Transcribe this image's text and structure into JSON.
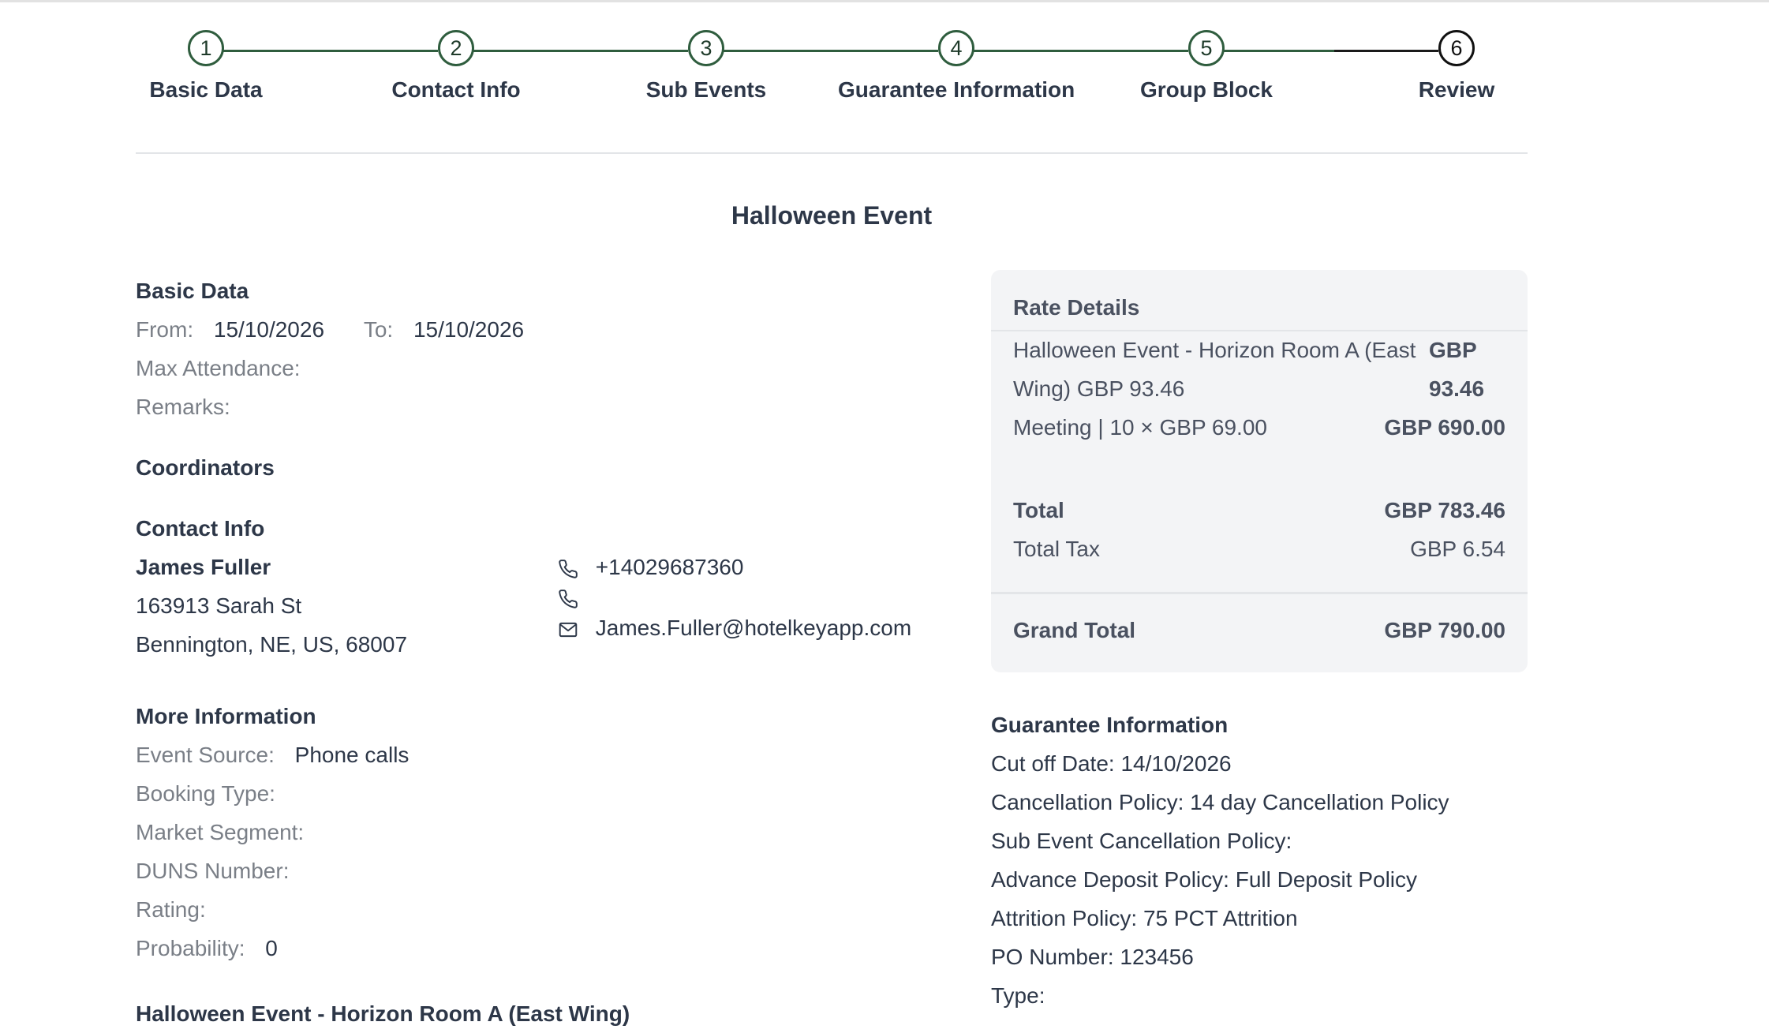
{
  "stepper": {
    "steps": [
      {
        "number": "1",
        "label": "Basic Data"
      },
      {
        "number": "2",
        "label": "Contact Info"
      },
      {
        "number": "3",
        "label": "Sub Events"
      },
      {
        "number": "4",
        "label": "Guarantee Information"
      },
      {
        "number": "5",
        "label": "Group Block"
      },
      {
        "number": "6",
        "label": "Review"
      }
    ],
    "current_step": 6,
    "colors": {
      "done": "#2f5d3e",
      "pending": "#1a1a1a"
    }
  },
  "event_title": "Halloween Event",
  "basic_data": {
    "title": "Basic Data",
    "from_label": "From:",
    "from_value": "15/10/2026",
    "to_label": "To:",
    "to_value": "15/10/2026",
    "max_attendance_label": "Max Attendance:",
    "remarks_label": "Remarks:"
  },
  "coordinators": {
    "title": "Coordinators"
  },
  "contact_info": {
    "title": "Contact Info",
    "name": "James Fuller",
    "address_line1": "163913 Sarah St",
    "address_line2": "Bennington, NE, US, 68007",
    "phone": "+14029687360",
    "phone2": "",
    "email": "James.Fuller@hotelkeyapp.com"
  },
  "more_information": {
    "title": "More Information",
    "event_source_label": "Event Source:",
    "event_source_value": "Phone calls",
    "booking_type_label": "Booking Type:",
    "market_segment_label": "Market Segment:",
    "duns_label": "DUNS Number:",
    "rating_label": "Rating:",
    "probability_label": "Probability:",
    "probability_value": "0"
  },
  "sub_event_heading": "Halloween Event - Horizon Room A (East Wing)",
  "rate_details": {
    "title": "Rate Details",
    "item1_desc_line1": "Halloween Event - Horizon Room A (East",
    "item1_desc_line2": "Wing) GBP 93.46",
    "item1_amount_line1": "GBP",
    "item1_amount_line2": "93.46",
    "item2_desc": "Meeting | 10 × GBP 69.00",
    "item2_amount": "GBP 690.00",
    "total_label": "Total",
    "total_value": "GBP 783.46",
    "total_tax_label": "Total Tax",
    "total_tax_value": "GBP 6.54",
    "grand_total_label": "Grand Total",
    "grand_total_value": "GBP 790.00"
  },
  "guarantee": {
    "title": "Guarantee Information",
    "cut_off": "Cut off Date: 14/10/2026",
    "cancellation": "Cancellation Policy: 14 day Cancellation Policy",
    "sub_event_cancellation": "Sub Event Cancellation Policy:",
    "advance_deposit": "Advance Deposit Policy: Full Deposit Policy",
    "attrition": "Attrition Policy: 75 PCT Attrition",
    "po_number": "PO Number: 123456",
    "type": "Type:"
  }
}
